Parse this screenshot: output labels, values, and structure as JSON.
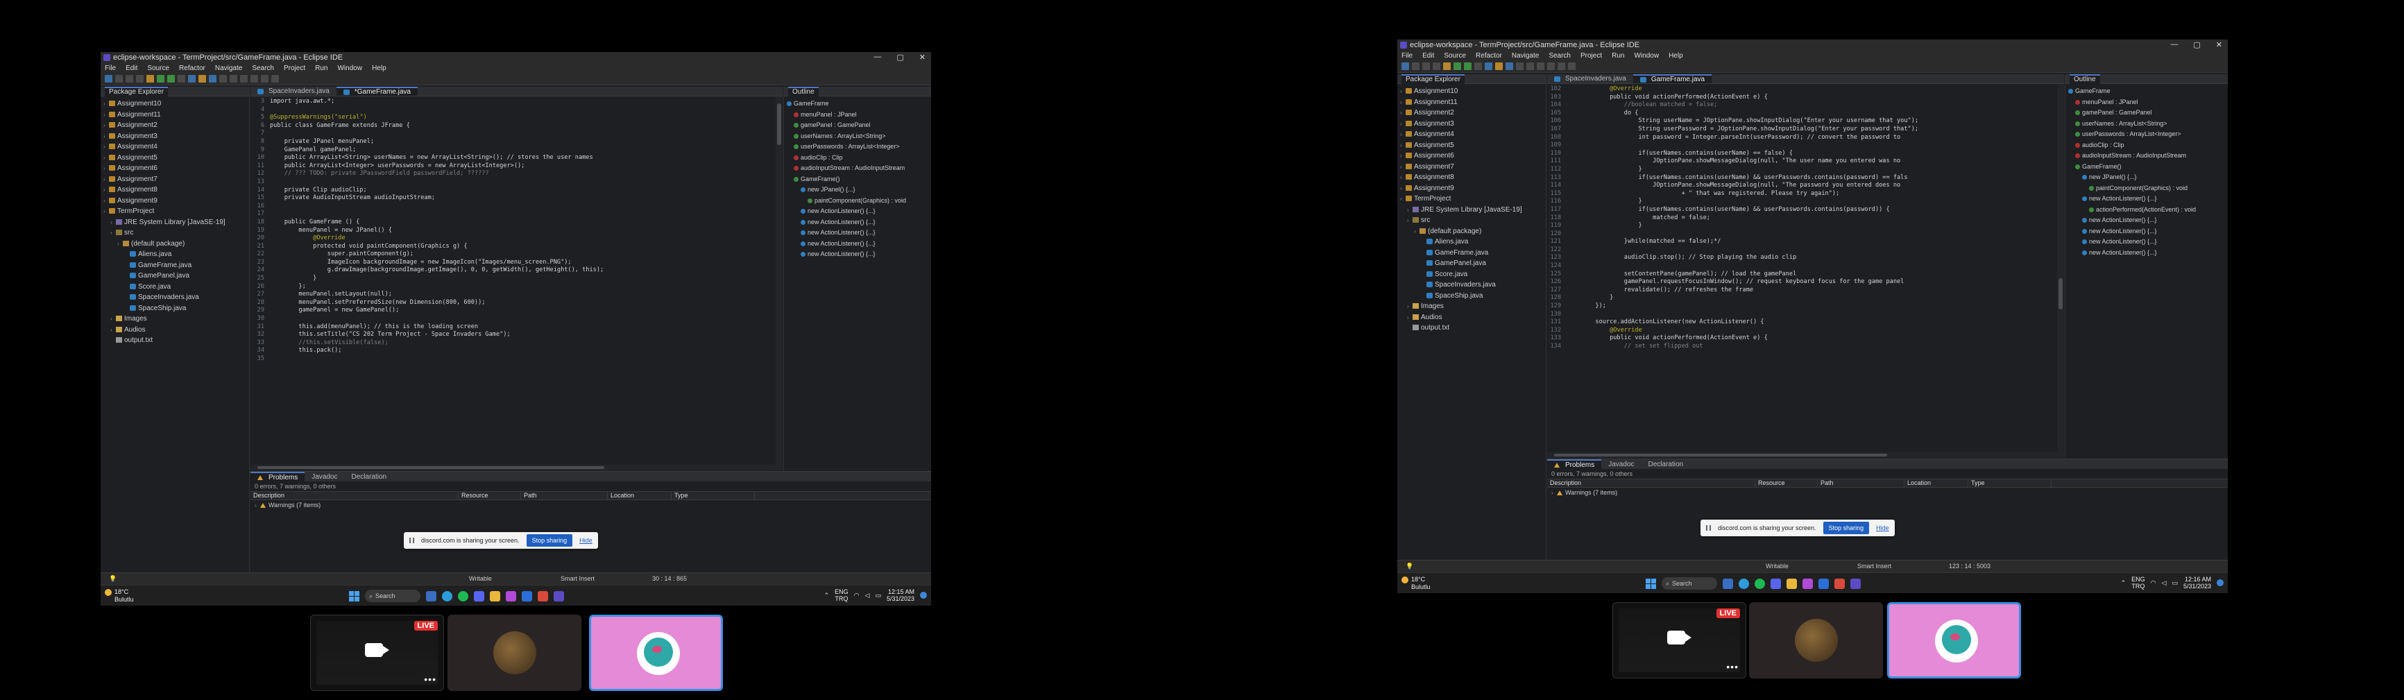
{
  "window": {
    "title": "eclipse-workspace - TermProject/src/GameFrame.java - Eclipse IDE",
    "controls": [
      "—",
      "▢",
      "✕"
    ]
  },
  "menu": [
    "File",
    "Edit",
    "Source",
    "Refactor",
    "Navigate",
    "Search",
    "Project",
    "Run",
    "Window",
    "Help"
  ],
  "package_explorer": {
    "tab": "Package Explorer",
    "items": [
      {
        "label": "Assignment10",
        "type": "project",
        "level": 0
      },
      {
        "label": "Assignment11",
        "type": "project",
        "level": 0
      },
      {
        "label": "Assignment2",
        "type": "project",
        "level": 0
      },
      {
        "label": "Assignment3",
        "type": "project",
        "level": 0
      },
      {
        "label": "Assignment4",
        "type": "project",
        "level": 0
      },
      {
        "label": "Assignment5",
        "type": "project",
        "level": 0
      },
      {
        "label": "Assignment6",
        "type": "project",
        "level": 0
      },
      {
        "label": "Assignment7",
        "type": "project",
        "level": 0
      },
      {
        "label": "Assignment8",
        "type": "project",
        "level": 0
      },
      {
        "label": "Assignment9",
        "type": "project",
        "level": 0
      },
      {
        "label": "TermProject",
        "type": "project",
        "level": 0
      },
      {
        "label": "JRE System Library [JavaSE-19]",
        "type": "lib",
        "level": 1
      },
      {
        "label": "src",
        "type": "src",
        "level": 1
      },
      {
        "label": "(default package)",
        "type": "pkg",
        "level": 2
      },
      {
        "label": "Aliens.java",
        "type": "java",
        "level": 3
      },
      {
        "label": "GameFrame.java",
        "type": "java",
        "level": 3
      },
      {
        "label": "GamePanel.java",
        "type": "java",
        "level": 3
      },
      {
        "label": "Score.java",
        "type": "java",
        "level": 3
      },
      {
        "label": "SpaceInvaders.java",
        "type": "java",
        "level": 3
      },
      {
        "label": "SpaceShip.java",
        "type": "java",
        "level": 3
      },
      {
        "label": "Images",
        "type": "folder",
        "level": 1
      },
      {
        "label": "Audios",
        "type": "folder",
        "level": 1
      },
      {
        "label": "output.txt",
        "type": "file",
        "level": 1
      }
    ]
  },
  "editor_tabs": [
    "SpaceInvaders.java",
    "*GameFrame.java"
  ],
  "editor_tabs_b": [
    "SpaceInvaders.java",
    "GameFrame.java"
  ],
  "code_a": [
    {
      "n": "3",
      "t": "import java.awt.*;"
    },
    {
      "n": "4",
      "t": ""
    },
    {
      "n": "5",
      "t": "@SuppressWarnings(\"serial\")"
    },
    {
      "n": "6",
      "t": "public class GameFrame extends JFrame {"
    },
    {
      "n": "7",
      "t": ""
    },
    {
      "n": "8",
      "t": "    private JPanel menuPanel;"
    },
    {
      "n": "9",
      "t": "    GamePanel gamePanel;"
    },
    {
      "n": "10",
      "t": "    public ArrayList<String> userNames = new ArrayList<String>(); // stores the user names"
    },
    {
      "n": "11",
      "t": "    public ArrayList<Integer> userPasswords = new ArrayList<Integer>();"
    },
    {
      "n": "12",
      "t": "    // ??? TODO: private JPasswordField passwordField; ??????"
    },
    {
      "n": "13",
      "t": ""
    },
    {
      "n": "14",
      "t": "    private Clip audioClip;"
    },
    {
      "n": "15",
      "t": "    private AudioInputStream audioInputStream;"
    },
    {
      "n": "16",
      "t": ""
    },
    {
      "n": "17",
      "t": ""
    },
    {
      "n": "18",
      "t": "    public GameFrame () {"
    },
    {
      "n": "19",
      "t": "        menuPanel = new JPanel() {"
    },
    {
      "n": "20",
      "t": "            @Override"
    },
    {
      "n": "21",
      "t": "            protected void paintComponent(Graphics g) {"
    },
    {
      "n": "22",
      "t": "                super.paintComponent(g);"
    },
    {
      "n": "23",
      "t": "                ImageIcon backgroundImage = new ImageIcon(\"Images/menu_screen.PNG\");"
    },
    {
      "n": "24",
      "t": "                g.drawImage(backgroundImage.getImage(), 0, 0, getWidth(), getHeight(), this);"
    },
    {
      "n": "25",
      "t": "            }"
    },
    {
      "n": "26",
      "t": "        };"
    },
    {
      "n": "27",
      "t": "        menuPanel.setLayout(null);"
    },
    {
      "n": "28",
      "t": "        menuPanel.setPreferredSize(new Dimension(800, 600));"
    },
    {
      "n": "29",
      "t": "        gamePanel = new GamePanel();"
    },
    {
      "n": "30",
      "t": ""
    },
    {
      "n": "31",
      "t": "        this.add(menuPanel); // this is the loading screen"
    },
    {
      "n": "32",
      "t": "        this.setTitle(\"CS 202 Term Project - Space Invaders Game\");"
    },
    {
      "n": "33",
      "t": "        //this.setVisible(false);"
    },
    {
      "n": "34",
      "t": "        this.pack();"
    },
    {
      "n": "35",
      "t": ""
    }
  ],
  "code_b": [
    {
      "n": "102",
      "t": "            @Override"
    },
    {
      "n": "103",
      "t": "            public void actionPerformed(ActionEvent e) {"
    },
    {
      "n": "104",
      "t": "                //boolean matched = false;"
    },
    {
      "n": "105",
      "t": "                do {"
    },
    {
      "n": "106",
      "t": "                    String userName = JOptionPane.showInputDialog(\"Enter your username that you\");"
    },
    {
      "n": "107",
      "t": "                    String userPassword = JOptionPane.showInputDialog(\"Enter your password that\");"
    },
    {
      "n": "108",
      "t": "                    int password = Integer.parseInt(userPassword); // convert the password to"
    },
    {
      "n": "109",
      "t": ""
    },
    {
      "n": "110",
      "t": "                    if(userNames.contains(userName) == false) {"
    },
    {
      "n": "111",
      "t": "                        JOptionPane.showMessageDialog(null, \"The user name you entered was no"
    },
    {
      "n": "112",
      "t": "                    }"
    },
    {
      "n": "113",
      "t": "                    if(userNames.contains(userName) && userPasswords.contains(password) == fals"
    },
    {
      "n": "114",
      "t": "                        JOptionPane.showMessageDialog(null, \"The password you entered does no"
    },
    {
      "n": "115",
      "t": "                                + \" that was registered. Please try again\");"
    },
    {
      "n": "116",
      "t": "                    }"
    },
    {
      "n": "117",
      "t": "                    if(userNames.contains(userName) && userPasswords.contains(password)) {"
    },
    {
      "n": "118",
      "t": "                        matched = false;"
    },
    {
      "n": "119",
      "t": "                    }"
    },
    {
      "n": "120",
      "t": ""
    },
    {
      "n": "121",
      "t": "                }while(matched == false);*/"
    },
    {
      "n": "122",
      "t": ""
    },
    {
      "n": "123",
      "t": "                audioClip.stop(); // Stop playing the audio clip"
    },
    {
      "n": "124",
      "t": ""
    },
    {
      "n": "125",
      "t": "                setContentPane(gamePanel); // load the gamePanel"
    },
    {
      "n": "126",
      "t": "                gamePanel.requestFocusInWindow(); // request keyboard focus for the game panel"
    },
    {
      "n": "127",
      "t": "                revalidate(); // refreshes the frame"
    },
    {
      "n": "128",
      "t": "            }"
    },
    {
      "n": "129",
      "t": "        });"
    },
    {
      "n": "130",
      "t": ""
    },
    {
      "n": "131",
      "t": "        source.addActionListener(new ActionListener() {"
    },
    {
      "n": "132",
      "t": "            @Override"
    },
    {
      "n": "133",
      "t": "            public void actionPerformed(ActionEvent e) {"
    },
    {
      "n": "134",
      "t": "                // set set flipped out"
    }
  ],
  "outline": {
    "tab": "Outline",
    "items_a": [
      {
        "label": "GameFrame",
        "level": 0,
        "kind": "cls"
      },
      {
        "label": "menuPanel : JPanel",
        "level": 1,
        "kind": "priv"
      },
      {
        "label": "gamePanel : GamePanel",
        "level": 1,
        "kind": "pub"
      },
      {
        "label": "userNames : ArrayList<String>",
        "level": 1,
        "kind": "pub"
      },
      {
        "label": "userPasswords : ArrayList<Integer>",
        "level": 1,
        "kind": "pub"
      },
      {
        "label": "audioClip : Clip",
        "level": 1,
        "kind": "priv"
      },
      {
        "label": "audioInputStream : AudioInputStream",
        "level": 1,
        "kind": "priv"
      },
      {
        "label": "GameFrame()",
        "level": 1,
        "kind": "pub"
      },
      {
        "label": "new JPanel() {...}",
        "level": 2,
        "kind": "cls"
      },
      {
        "label": "paintComponent(Graphics) : void",
        "level": 3,
        "kind": "pub"
      },
      {
        "label": "new ActionListener() {...}",
        "level": 2,
        "kind": "cls"
      },
      {
        "label": "new ActionListener() {...}",
        "level": 2,
        "kind": "cls"
      },
      {
        "label": "new ActionListener() {...}",
        "level": 2,
        "kind": "cls"
      },
      {
        "label": "new ActionListener() {...}",
        "level": 2,
        "kind": "cls"
      },
      {
        "label": "new ActionListener() {...}",
        "level": 2,
        "kind": "cls"
      }
    ],
    "items_b": [
      {
        "label": "GameFrame",
        "level": 0,
        "kind": "cls"
      },
      {
        "label": "menuPanel : JPanel",
        "level": 1,
        "kind": "priv"
      },
      {
        "label": "gamePanel : GamePanel",
        "level": 1,
        "kind": "pub"
      },
      {
        "label": "userNames : ArrayList<String>",
        "level": 1,
        "kind": "pub"
      },
      {
        "label": "userPasswords : ArrayList<Integer>",
        "level": 1,
        "kind": "pub"
      },
      {
        "label": "audioClip : Clip",
        "level": 1,
        "kind": "priv"
      },
      {
        "label": "audioInputStream : AudioInputStream",
        "level": 1,
        "kind": "priv"
      },
      {
        "label": "GameFrame()",
        "level": 1,
        "kind": "pub"
      },
      {
        "label": "new JPanel() {...}",
        "level": 2,
        "kind": "cls"
      },
      {
        "label": "paintComponent(Graphics) : void",
        "level": 3,
        "kind": "pub"
      },
      {
        "label": "new ActionListener() {...}",
        "level": 2,
        "kind": "cls"
      },
      {
        "label": "actionPerformed(ActionEvent) : void",
        "level": 3,
        "kind": "pub"
      },
      {
        "label": "new ActionListener() {...}",
        "level": 2,
        "kind": "cls"
      },
      {
        "label": "new ActionListener() {...}",
        "level": 2,
        "kind": "cls"
      },
      {
        "label": "new ActionListener() {...}",
        "level": 2,
        "kind": "cls"
      },
      {
        "label": "new ActionListener() {...}",
        "level": 2,
        "kind": "cls"
      }
    ]
  },
  "problems": {
    "tabs": [
      "Problems",
      "Javadoc",
      "Declaration"
    ],
    "summary": "0 errors, 7 warnings, 0 others",
    "columns": [
      "Description",
      "Resource",
      "Path",
      "Location",
      "Type"
    ],
    "row": "Warnings (7 items)"
  },
  "share": {
    "text": "discord.com is sharing your screen.",
    "stop": "Stop sharing",
    "hide": "Hide"
  },
  "status_a": {
    "writable": "Writable",
    "mode": "Smart Insert",
    "pos": "30 : 14 : 865"
  },
  "status_b": {
    "writable": "Writable",
    "mode": "Smart Insert",
    "pos": "123 : 14 : 5003"
  },
  "taskbar": {
    "temp": "18°C",
    "weather": "Bulutlu",
    "search": "Search",
    "lang1": "ENG",
    "lang2": "TRQ",
    "time_a": "12:15 AM",
    "time_b": "12:16 AM",
    "date": "5/31/2023"
  },
  "call": {
    "live": "LIVE",
    "more": "•••"
  }
}
